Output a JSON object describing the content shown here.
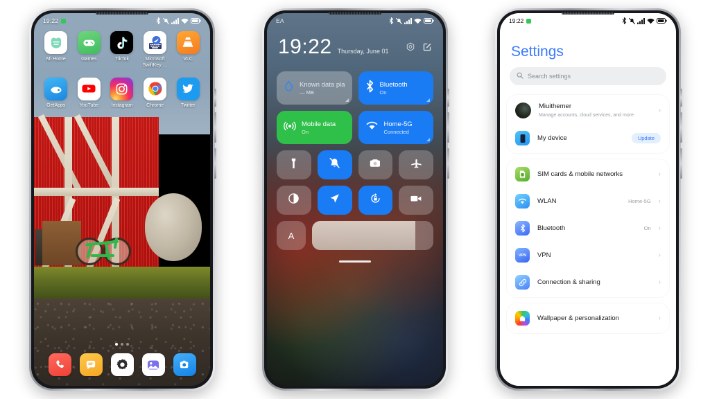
{
  "canvas": {
    "background": "#ffffff"
  },
  "phone1": {
    "name": "home-screen",
    "status_bar": {
      "time": "19:22",
      "recording_dot": true,
      "icons": [
        "bluetooth-icon",
        "vibrate-icon",
        "signal-icon",
        "wifi-icon",
        "battery-icon"
      ]
    },
    "apps": [
      {
        "label": "Mi Home",
        "icon": "mi-home-icon"
      },
      {
        "label": "Games",
        "icon": "games-icon"
      },
      {
        "label": "TikTok",
        "icon": "tiktok-icon"
      },
      {
        "label": "Microsoft SwiftKey …",
        "icon": "swiftkey-icon"
      },
      {
        "label": "VLC",
        "icon": "vlc-icon"
      },
      {
        "label": "GetApps",
        "icon": "getapps-icon"
      },
      {
        "label": "YouTube",
        "icon": "youtube-icon"
      },
      {
        "label": "Instagram",
        "icon": "instagram-icon"
      },
      {
        "label": "Chrome",
        "icon": "chrome-icon"
      },
      {
        "label": "Twitter",
        "icon": "twitter-icon"
      }
    ],
    "dock": [
      {
        "label": "Phone",
        "icon": "phone-icon"
      },
      {
        "label": "Messages",
        "icon": "messages-icon"
      },
      {
        "label": "Settings",
        "icon": "settings-gear-icon"
      },
      {
        "label": "Gallery",
        "icon": "gallery-icon"
      },
      {
        "label": "Camera",
        "icon": "camera-icon"
      }
    ],
    "page_indicator": {
      "pages": 3,
      "active": 1
    },
    "wallpaper": "red-barn-with-bicycle-and-hay-bale"
  },
  "phone2": {
    "name": "control-center",
    "status_bar": {
      "carrier": "EA",
      "icons": [
        "bluetooth-icon",
        "vibrate-icon",
        "signal-icon",
        "wifi-icon",
        "battery-icon"
      ]
    },
    "header": {
      "time": "19:22",
      "date": "Thursday, June 01",
      "actions": [
        {
          "name": "settings-hex-icon",
          "label": "Settings"
        },
        {
          "name": "edit-icon",
          "label": "Edit"
        }
      ]
    },
    "big_tiles": [
      {
        "title": "Known data plan",
        "sub": "— MB",
        "state": "off",
        "icon": "data-drop-icon"
      },
      {
        "title": "Bluetooth",
        "sub": "On",
        "state": "blue",
        "icon": "bluetooth-icon"
      },
      {
        "title": "Mobile data",
        "sub": "On",
        "state": "green",
        "icon": "mobile-data-icon"
      },
      {
        "title": "Home-5G",
        "sub": "Connected",
        "state": "blue",
        "icon": "wifi-icon"
      }
    ],
    "small_tiles": [
      {
        "name": "flashlight-icon",
        "state": "off"
      },
      {
        "name": "silent-bell-off-icon",
        "state": "on"
      },
      {
        "name": "camera-icon",
        "state": "off"
      },
      {
        "name": "airplane-icon",
        "state": "off"
      },
      {
        "name": "dark-mode-icon",
        "state": "off"
      },
      {
        "name": "location-icon",
        "state": "on"
      },
      {
        "name": "rotation-lock-icon",
        "state": "on"
      },
      {
        "name": "screen-recorder-icon",
        "state": "off"
      }
    ],
    "brightness": {
      "auto_label": "A",
      "level_percent": 85
    },
    "accent_blue": "#1a7cf5",
    "accent_green": "#2fc04a"
  },
  "phone3": {
    "name": "settings-screen",
    "status_bar": {
      "time": "19:22",
      "recording_dot": true,
      "icons": [
        "bluetooth-icon",
        "vibrate-icon",
        "signal-icon",
        "wifi-icon",
        "battery-icon"
      ]
    },
    "title": "Settings",
    "search": {
      "placeholder": "Search settings",
      "icon": "search-icon"
    },
    "account_card": [
      {
        "title": "Miuithemer",
        "sub": "Manage accounts, cloud services, and more",
        "icon": "avatar",
        "value": "",
        "badge": ""
      },
      {
        "title": "My device",
        "sub": "",
        "icon": "my-device-icon",
        "value": "",
        "badge": "Update"
      }
    ],
    "network_card": [
      {
        "title": "SIM cards & mobile networks",
        "icon": "sim-card-icon",
        "value": ""
      },
      {
        "title": "WLAN",
        "icon": "wlan-icon",
        "value": "Home-5G"
      },
      {
        "title": "Bluetooth",
        "icon": "bluetooth-icon",
        "value": "On"
      },
      {
        "title": "VPN",
        "icon": "vpn-icon",
        "value": ""
      },
      {
        "title": "Connection & sharing",
        "icon": "link-icon",
        "value": ""
      }
    ],
    "personalization_card": [
      {
        "title": "Wallpaper & personalization",
        "icon": "wallpaper-icon",
        "value": ""
      }
    ],
    "title_color": "#3a7afe",
    "badge_color": "#3a7afe"
  }
}
